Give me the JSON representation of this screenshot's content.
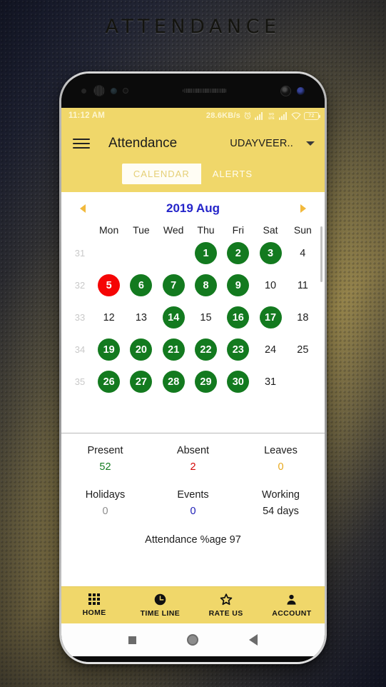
{
  "page": {
    "title": "ATTENDANCE"
  },
  "statusbar": {
    "time": "11:12 AM",
    "network_speed": "28.6KB/s",
    "battery_level": "72",
    "icons": [
      "alarm-icon",
      "signal-bars-icon",
      "volte-icon",
      "signal-bars-icon",
      "wifi-icon",
      "battery-icon"
    ]
  },
  "appbar": {
    "menu_icon": "hamburger-menu-icon",
    "title": "Attendance",
    "spinner_value": "UDAYVEER..",
    "spinner_icon": "chevron-down-icon"
  },
  "tabs": [
    {
      "label": "CALENDAR",
      "selected": true
    },
    {
      "label": "ALERTS",
      "selected": false
    }
  ],
  "calendar": {
    "prev_icon": "chevron-left-icon",
    "next_icon": "chevron-right-icon",
    "month_label": "2019 Aug",
    "weekday_headers": [
      "Mon",
      "Tue",
      "Wed",
      "Thu",
      "Fri",
      "Sat",
      "Sun"
    ],
    "colors": {
      "present": "#137a1f",
      "absent": "#f50505",
      "month": "#2424c9",
      "arrow": "#f2b93c"
    },
    "weeks": [
      {
        "week_number": "31",
        "days": [
          {
            "label": "",
            "state": "empty"
          },
          {
            "label": "",
            "state": "empty"
          },
          {
            "label": "",
            "state": "empty"
          },
          {
            "label": "1",
            "state": "present"
          },
          {
            "label": "2",
            "state": "present"
          },
          {
            "label": "3",
            "state": "present"
          },
          {
            "label": "4",
            "state": "none"
          }
        ]
      },
      {
        "week_number": "32",
        "days": [
          {
            "label": "5",
            "state": "absent"
          },
          {
            "label": "6",
            "state": "present"
          },
          {
            "label": "7",
            "state": "present"
          },
          {
            "label": "8",
            "state": "present"
          },
          {
            "label": "9",
            "state": "present"
          },
          {
            "label": "10",
            "state": "none"
          },
          {
            "label": "11",
            "state": "none"
          }
        ]
      },
      {
        "week_number": "33",
        "days": [
          {
            "label": "12",
            "state": "none"
          },
          {
            "label": "13",
            "state": "none"
          },
          {
            "label": "14",
            "state": "present"
          },
          {
            "label": "15",
            "state": "none"
          },
          {
            "label": "16",
            "state": "present"
          },
          {
            "label": "17",
            "state": "present"
          },
          {
            "label": "18",
            "state": "none"
          }
        ]
      },
      {
        "week_number": "34",
        "days": [
          {
            "label": "19",
            "state": "present"
          },
          {
            "label": "20",
            "state": "present"
          },
          {
            "label": "21",
            "state": "present"
          },
          {
            "label": "22",
            "state": "present"
          },
          {
            "label": "23",
            "state": "present"
          },
          {
            "label": "24",
            "state": "none"
          },
          {
            "label": "25",
            "state": "none"
          }
        ]
      },
      {
        "week_number": "35",
        "days": [
          {
            "label": "26",
            "state": "present"
          },
          {
            "label": "27",
            "state": "present"
          },
          {
            "label": "28",
            "state": "present"
          },
          {
            "label": "29",
            "state": "present"
          },
          {
            "label": "30",
            "state": "present"
          },
          {
            "label": "31",
            "state": "none"
          },
          {
            "label": "",
            "state": "empty"
          }
        ]
      }
    ]
  },
  "summary": {
    "rows": [
      [
        {
          "label": "Present",
          "value": "52",
          "color": "#137a1f"
        },
        {
          "label": "Absent",
          "value": "2",
          "color": "#d40606"
        },
        {
          "label": "Leaves",
          "value": "0",
          "color": "#e8a81c"
        }
      ],
      [
        {
          "label": "Holidays",
          "value": "0",
          "color": "#8d8d8d"
        },
        {
          "label": "Events",
          "value": "0",
          "color": "#1a1ab5"
        },
        {
          "label": "Working",
          "value": "54 days",
          "color": "#1d1d1d"
        }
      ]
    ],
    "total_label": "Attendance %age 97"
  },
  "bottomnav": [
    {
      "label": "HOME",
      "icon": "grid-apps-icon"
    },
    {
      "label": "TIME LINE",
      "icon": "clock-icon"
    },
    {
      "label": "RATE US",
      "icon": "star-icon"
    },
    {
      "label": "ACCOUNT",
      "icon": "person-icon"
    }
  ],
  "androidnav": [
    {
      "icon": "recents-square-icon"
    },
    {
      "icon": "home-circle-icon"
    },
    {
      "icon": "back-triangle-icon"
    }
  ]
}
